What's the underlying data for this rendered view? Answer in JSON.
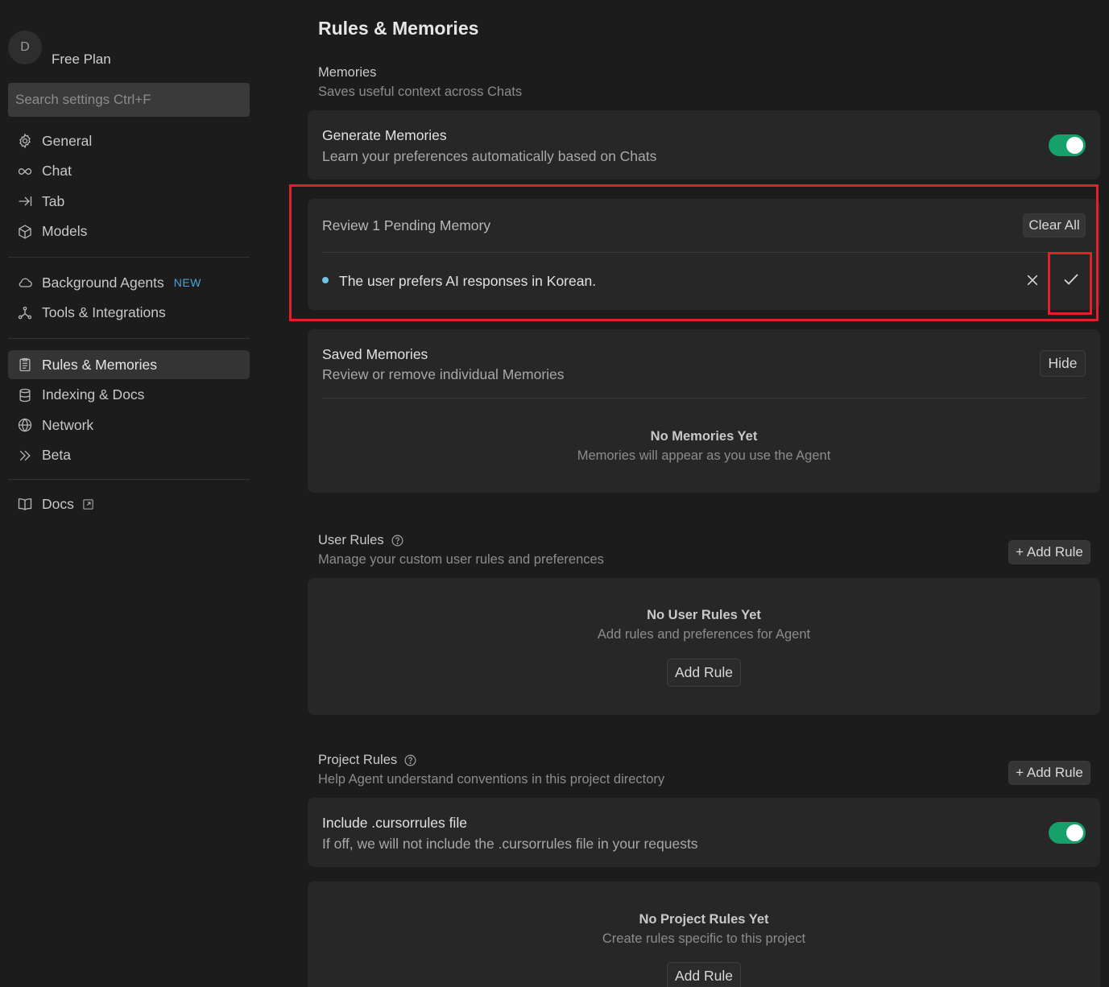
{
  "sidebar": {
    "avatar_initial": "D",
    "plan": "Free Plan",
    "search_placeholder": "Search settings Ctrl+F",
    "group1": [
      {
        "label": "General",
        "icon": "gear-icon"
      },
      {
        "label": "Chat",
        "icon": "infinity-icon"
      },
      {
        "label": "Tab",
        "icon": "arrow-right-bar-icon"
      },
      {
        "label": "Models",
        "icon": "cube-icon"
      }
    ],
    "group2": [
      {
        "label": "Background Agents",
        "icon": "cloud-icon",
        "badge": "NEW"
      },
      {
        "label": "Tools & Integrations",
        "icon": "network-nodes-icon"
      }
    ],
    "group3": [
      {
        "label": "Rules & Memories",
        "icon": "clipboard-icon",
        "active": true
      },
      {
        "label": "Indexing & Docs",
        "icon": "database-icon"
      },
      {
        "label": "Network",
        "icon": "globe-icon"
      },
      {
        "label": "Beta",
        "icon": "double-chevron-right-icon"
      }
    ],
    "group4": [
      {
        "label": "Docs",
        "icon": "book-icon"
      }
    ]
  },
  "main": {
    "title": "Rules & Memories",
    "memories": {
      "title": "Memories",
      "subtitle": "Saves useful context across Chats",
      "generate": {
        "title": "Generate Memories",
        "subtitle": "Learn your preferences automatically based on Chats",
        "enabled": true
      },
      "pending": {
        "title": "Review 1 Pending Memory",
        "clear_label": "Clear All",
        "items": [
          {
            "text": "The user prefers AI responses in Korean."
          }
        ]
      },
      "saved": {
        "title": "Saved Memories",
        "subtitle": "Review or remove individual Memories",
        "hide_label": "Hide",
        "empty_title": "No Memories Yet",
        "empty_subtitle": "Memories will appear as you use the Agent"
      }
    },
    "user_rules": {
      "title": "User Rules",
      "subtitle": "Manage your custom user rules and preferences",
      "add_label": "+ Add Rule",
      "empty_title": "No User Rules Yet",
      "empty_subtitle": "Add rules and preferences for Agent",
      "empty_button": "Add Rule"
    },
    "project_rules": {
      "title": "Project Rules",
      "subtitle": "Help Agent understand conventions in this project directory",
      "add_label": "+ Add Rule",
      "cursorrules": {
        "title": "Include .cursorrules file",
        "subtitle": "If off, we will not include the .cursorrules file in your requests",
        "enabled": true
      },
      "empty_title": "No Project Rules Yet",
      "empty_subtitle": "Create rules specific to this project",
      "empty_button": "Add Rule"
    }
  },
  "colors": {
    "accent_toggle": "#16a06a",
    "highlight": "#e0202a",
    "new_badge": "#4aa3d8",
    "pending_dot": "#6fc3e8"
  }
}
